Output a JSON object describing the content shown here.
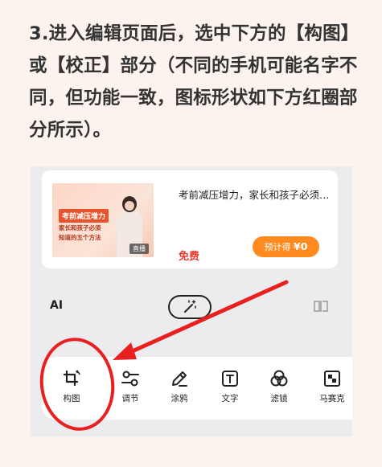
{
  "instruction": {
    "text": "3.进入编辑页面后，选中下方的【构图】或【校正】部分（不同的手机可能名字不同，但功能一致，图标形状如下方红圈部分所示）。"
  },
  "course_card": {
    "thumb_title": "考前减压增力",
    "thumb_line1": "家长和孩子必须",
    "thumb_line2": "知道的五个方法",
    "thumb_badge": "直播",
    "title": "考前减压增力，家长和孩子必须知道的五个方法",
    "price_label": "免费",
    "button_label": "预计得",
    "button_price": "¥0"
  },
  "editor": {
    "ai_label": "AI"
  },
  "toolbar": {
    "items": [
      {
        "label": "构图",
        "icon": "crop-rotate-icon"
      },
      {
        "label": "调节",
        "icon": "adjust-sliders-icon"
      },
      {
        "label": "涂鸦",
        "icon": "pen-icon"
      },
      {
        "label": "文字",
        "icon": "text-icon"
      },
      {
        "label": "滤镜",
        "icon": "filter-icon"
      },
      {
        "label": "马赛克",
        "icon": "mosaic-icon"
      }
    ]
  },
  "colors": {
    "annotation_red": "#e82020",
    "accent_orange": "#ff8a1f",
    "price_red": "#e93b2e",
    "page_background": "#fcf3ee"
  }
}
